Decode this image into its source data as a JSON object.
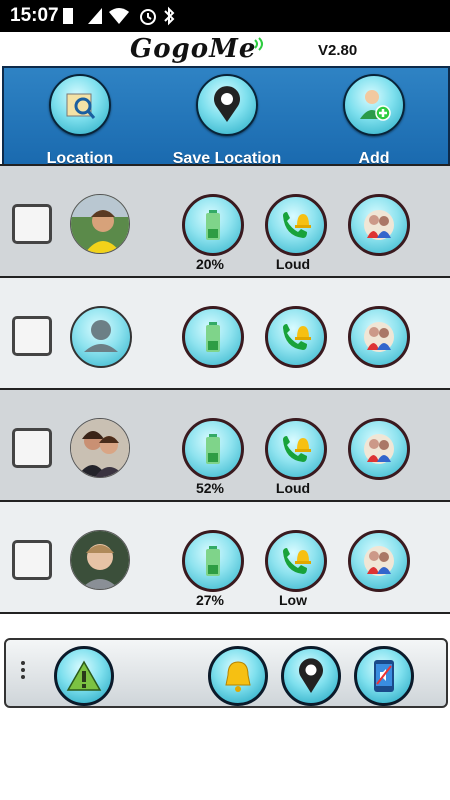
{
  "status_bar": {
    "time": "15:07"
  },
  "header": {
    "logo_text": "GogoMe",
    "version": "V2.80"
  },
  "toolbar": {
    "location_label": "Location",
    "save_location_label": "Save Location",
    "add_label": "Add"
  },
  "members": [
    {
      "battery": "20%",
      "ring_mode": "Loud",
      "avatar": "boy-stadium-photo",
      "checked": false
    },
    {
      "battery": "",
      "ring_mode": "",
      "avatar": "default-person-placeholder",
      "checked": false
    },
    {
      "battery": "52%",
      "ring_mode": "Loud",
      "avatar": "couple-photo",
      "checked": false
    },
    {
      "battery": "27%",
      "ring_mode": "Low",
      "avatar": "boy-portrait-photo",
      "checked": false
    }
  ],
  "bottom_bar": {
    "icons": [
      "menu-dots-icon",
      "warning-icon",
      "bell-icon",
      "location-pin-icon",
      "phone-mute-icon"
    ]
  },
  "colors": {
    "toolbar_blue": "#1f74b8",
    "button_cyan": "#7fe0ee",
    "row_dark": "#d2d6d9",
    "row_light": "#eceff1"
  }
}
